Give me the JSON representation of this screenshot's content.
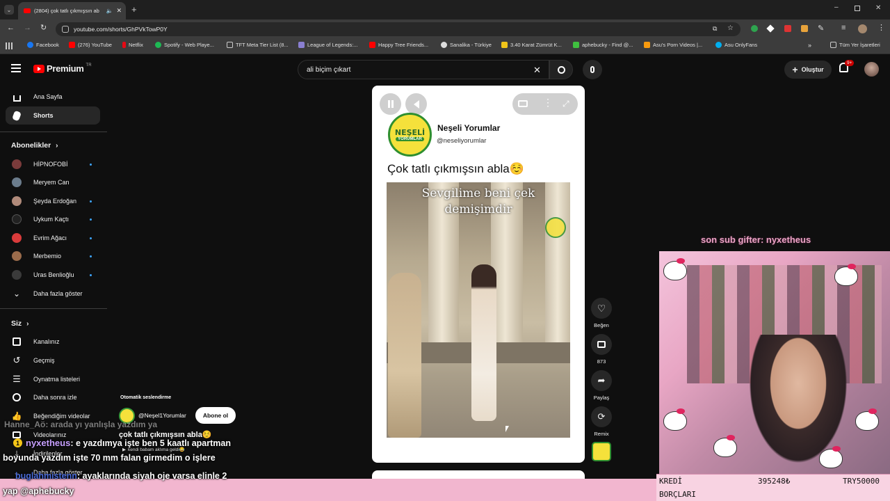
{
  "browser": {
    "tab_title": "(2804) çok tatlı çıkmışsın ab",
    "url": "youtube.com/shorts/GhPVkTowP0Y",
    "bookmarks": [
      "Facebook",
      "(276) YouTube",
      "Netflix",
      "Spotify - Web Playe...",
      "TFT Meta Tier List (8...",
      "League of Legends:...",
      "Happy Tree Friends...",
      "Sanalika - Türkiye",
      "3.40 Karat Zümrüt K...",
      "aphebucky - Find @...",
      "Asu's Porn Videos |...",
      "Asu OnlyFans"
    ],
    "all_bookmarks": "Tüm Yer İşaretleri"
  },
  "youtube": {
    "logo_text": "Premium",
    "logo_badge": "TR",
    "search_value": "ali biçim çıkart",
    "create_label": "Oluştur",
    "notif_count": "9+",
    "sidebar": {
      "main": [
        {
          "label": "Ana Sayfa",
          "icon": "home-icon"
        },
        {
          "label": "Shorts",
          "icon": "shorts-icon"
        }
      ],
      "subs_title": "Abonelikler",
      "subs": [
        {
          "label": "HİPNOFOBİ",
          "dot": true,
          "color": "#7a3b3b"
        },
        {
          "label": "Meryem Can",
          "dot": false,
          "color": "#6b7c8c"
        },
        {
          "label": "Şeyda Erdoğan",
          "dot": true,
          "color": "#b08a7a"
        },
        {
          "label": "Uykum Kaçtı",
          "dot": true,
          "color": "#222222"
        },
        {
          "label": "Evrim Ağacı",
          "dot": true,
          "color": "#d93b3b"
        },
        {
          "label": "Merbemio",
          "dot": true,
          "color": "#9a6b4b"
        },
        {
          "label": "Uras Benlioğlu",
          "dot": true,
          "color": "#3a3a3a"
        }
      ],
      "show_more": "Daha fazla göster",
      "you_title": "Siz",
      "you": [
        {
          "label": "Kanalınız",
          "icon": "channel-icon"
        },
        {
          "label": "Geçmiş",
          "icon": "history-icon"
        },
        {
          "label": "Oynatma listeleri",
          "icon": "playlist-icon"
        },
        {
          "label": "Daha sonra izle",
          "icon": "clock-icon"
        },
        {
          "label": "Beğendiğim videolar",
          "icon": "like-icon"
        },
        {
          "label": "Videolarınız",
          "icon": "video-icon"
        },
        {
          "label": "İndirilenler",
          "icon": "download-icon"
        },
        {
          "label": "Daha fazla göster",
          "icon": "chevron-down-icon"
        }
      ]
    },
    "short": {
      "channel_name": "Neşeli Yorumlar",
      "channel_handle": "@neseliyorumlar",
      "title": "Çok tatlı çıkmışsın abla☺️",
      "overlay_text_line1": "Sevgilime beni çek",
      "overlay_text_line2": "demişimdir",
      "logo_line1": "NEŞELİ",
      "logo_line2": "YORUMLAR"
    },
    "actions": {
      "like": "Beğen",
      "comments": "873",
      "share": "Paylaş",
      "remix": "Remix"
    },
    "autodub": {
      "label": "Otomatik seslendirme",
      "channel": "@Neşel1Yorumlar",
      "subscribe": "Abone ol",
      "title": "çok tatlı çıkmışsın abla☺️",
      "music": "kendi babam aklıma geldi😂"
    }
  },
  "stream": {
    "chat": [
      {
        "user": "Hanne_Aö",
        "text": ": arada yı yanlışla yazdım ya"
      },
      {
        "user": "nyxetheus",
        "text": ": e yazdımya işte ben 5 kaatlı apartman"
      },
      {
        "user": "",
        "text": "boyunda yazdım işte 70 mm falan girmedim o işlere"
      },
      {
        "user": "buglahmistenn",
        "text": ": ayaklarında siyah oje varsa elinle 2"
      },
      {
        "user": "",
        "text": "yap @aphebucky"
      }
    ],
    "badge_number": "1",
    "sub_gifter": "son sub gifter: nyxetheus",
    "debt_label_1": "KREDİ",
    "debt_label_2": "BORÇLARI",
    "debt_value": "395248₺",
    "debt_extra": "TRY50000"
  }
}
